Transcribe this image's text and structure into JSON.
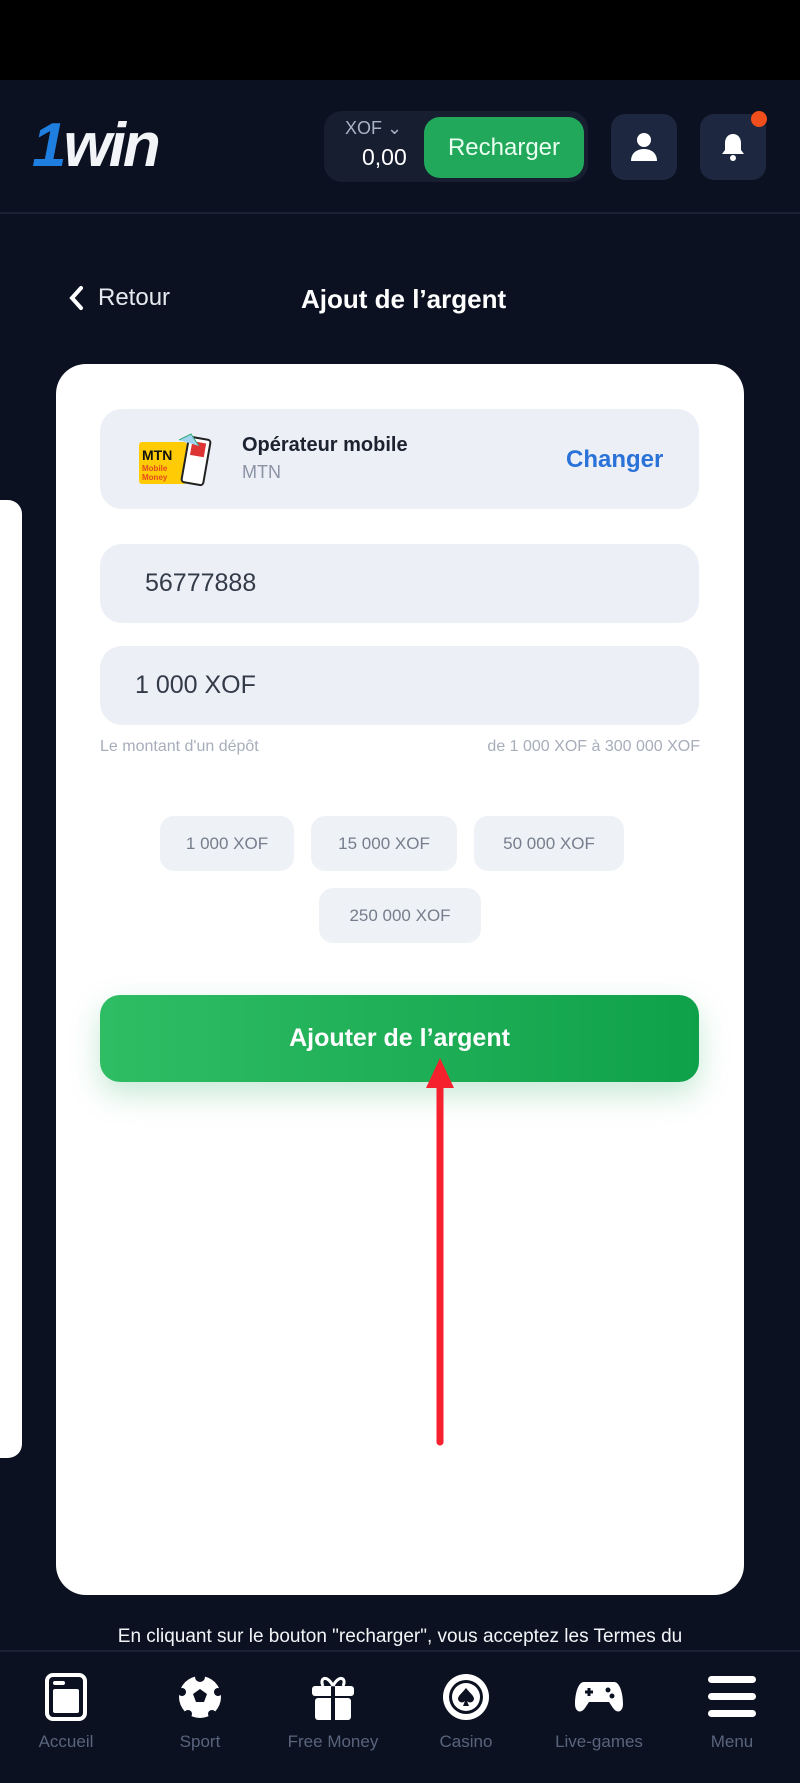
{
  "header": {
    "logo": "1win",
    "currency": "XOF",
    "balance": "0,00",
    "recharge_label": "Recharger"
  },
  "page": {
    "back_label": "Retour",
    "title": "Ajout de l’argent"
  },
  "operator": {
    "title": "Opérateur mobile",
    "name": "MTN",
    "change_label": "Changer",
    "logo_text": "MTN Mobile Money"
  },
  "form": {
    "phone_value": "56777888",
    "amount_value": "1 000 XOF",
    "amount_label": "Le montant d'un dépôt",
    "amount_range": "de 1 000 XOF à 300 000 XOF",
    "chips": [
      "1 000 XOF",
      "15 000 XOF",
      "50 000 XOF",
      "250 000 XOF"
    ],
    "submit_label": "Ajouter de l’argent"
  },
  "terms": "En cliquant sur le bouton \"recharger\", vous acceptez les Termes du",
  "nav": [
    {
      "label": "Accueil",
      "icon": "home-icon"
    },
    {
      "label": "Sport",
      "icon": "soccer-ball-icon"
    },
    {
      "label": "Free Money",
      "icon": "gift-icon"
    },
    {
      "label": "Casino",
      "icon": "casino-chip-icon"
    },
    {
      "label": "Live-games",
      "icon": "gamepad-icon"
    },
    {
      "label": "Menu",
      "icon": "menu-icon"
    }
  ],
  "colors": {
    "accent_green": "#21a85a",
    "link_blue": "#2a72d8",
    "background": "#0b1120",
    "annotation_arrow": "#f5222d"
  }
}
